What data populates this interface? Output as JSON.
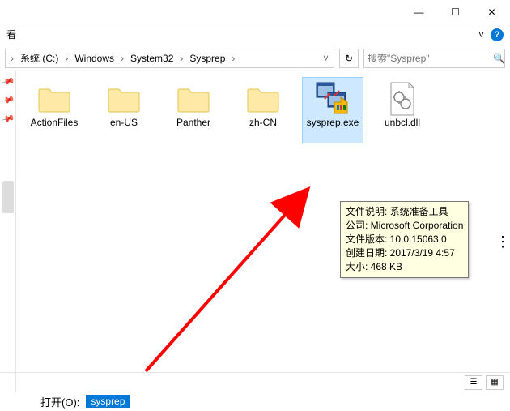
{
  "titlebar": {
    "minimize": "—",
    "maximize": "☐",
    "close": "✕"
  },
  "ribbon": {
    "tab": "看",
    "expand": "˅",
    "help": "?"
  },
  "breadcrumb": {
    "items": [
      "系统 (C:)",
      "Windows",
      "System32",
      "Sysprep"
    ],
    "chev": "›",
    "dropdown": "˅"
  },
  "refresh": "↻",
  "search": {
    "placeholder": "搜索\"Sysprep\"",
    "icon": "🔍"
  },
  "items": [
    {
      "label": "ActionFiles"
    },
    {
      "label": "en-US"
    },
    {
      "label": "Panther"
    },
    {
      "label": "zh-CN"
    },
    {
      "label": "sysprep.exe"
    },
    {
      "label": "unbcl.dll"
    }
  ],
  "tooltip": {
    "l1": "文件说明: 系统准备工具",
    "l2": "公司: Microsoft Corporation",
    "l3": "文件版本: 10.0.15063.0",
    "l4": "创建日期: 2017/3/19 4:57",
    "l5": "大小: 468 KB"
  },
  "bottom": {
    "label": "打开(O):",
    "value": "sysprep"
  }
}
